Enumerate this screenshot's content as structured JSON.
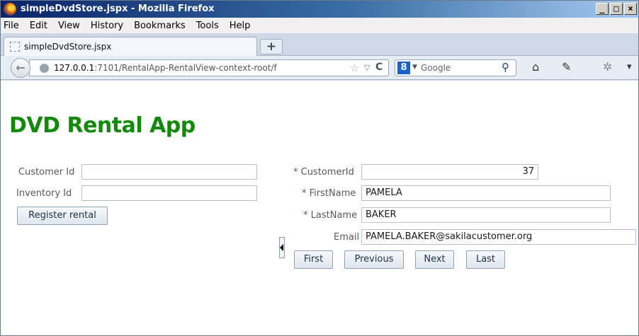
{
  "window": {
    "title": "simpleDvdStore.jspx - Mozilla Firefox",
    "min_label": "_",
    "max_label": "□",
    "close_label": "×"
  },
  "menu": [
    "File",
    "Edit",
    "View",
    "History",
    "Bookmarks",
    "Tools",
    "Help"
  ],
  "tab": {
    "title": "simpleDvdStore.jspx",
    "new_tab_label": "+"
  },
  "nav": {
    "back_label": "←",
    "url_host": "127.0.0.1",
    "url_rest": ":7101/RentalApp-RentalView-context-root/f",
    "star": "☆",
    "dropdown": "▽",
    "reload": "C",
    "search_engine_glyph": "8",
    "search_engine_dropdown": "▼",
    "search_placeholder": "Google",
    "search_icon": "⚲",
    "home_icon": "⌂",
    "tools_icon": "✎",
    "addon_icon": "✲",
    "menu_icon": "▾"
  },
  "app": {
    "title": "DVD Rental App"
  },
  "rental_form": {
    "customer_id_label": "Customer Id",
    "customer_id_value": "",
    "inventory_id_label": "Inventory Id",
    "inventory_id_value": "",
    "register_label": "Register rental"
  },
  "customer_form": {
    "required_marker": "*",
    "customer_id_label": "CustomerId",
    "customer_id_value": "37",
    "first_name_label": "FirstName",
    "first_name_value": "PAMELA",
    "last_name_label": "LastName",
    "last_name_value": "BAKER",
    "email_label": "Email",
    "email_value": "PAMELA.BAKER@sakilacustomer.org"
  },
  "pager": {
    "first": "First",
    "previous": "Previous",
    "next": "Next",
    "last": "Last"
  }
}
